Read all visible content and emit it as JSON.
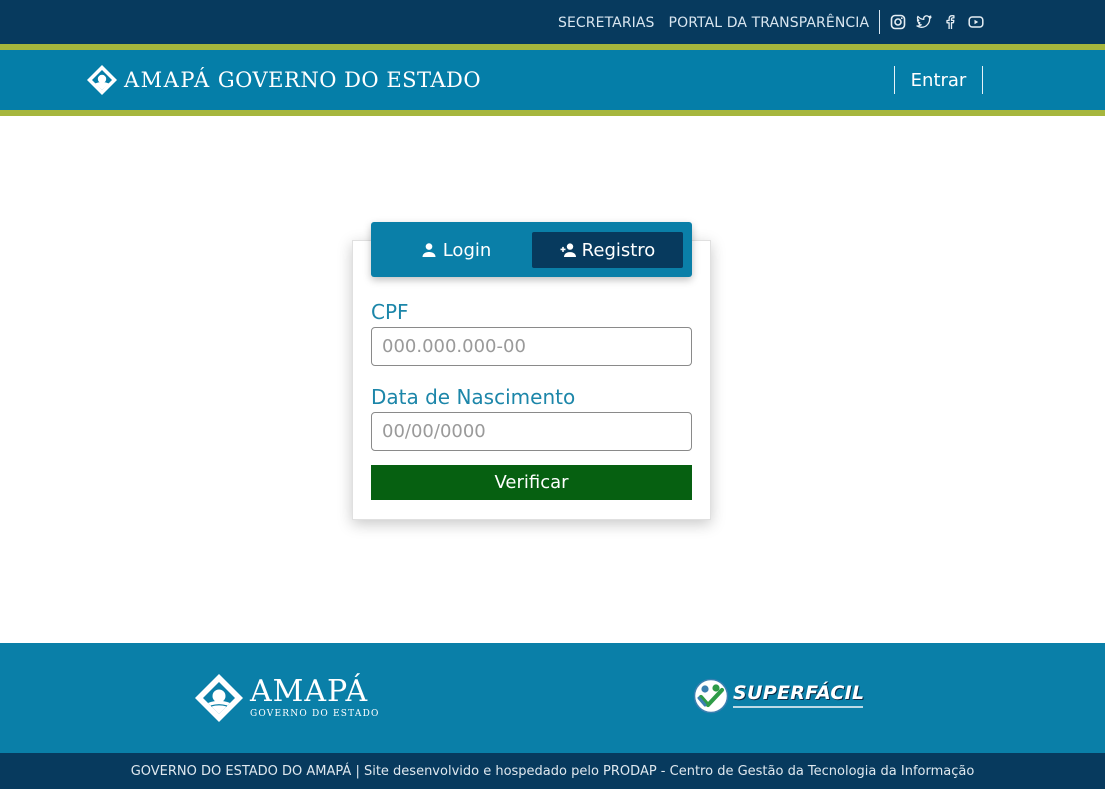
{
  "topbar": {
    "links": [
      "SECRETARIAS",
      "PORTAL DA TRANSPARÊNCIA"
    ],
    "socials": [
      "instagram-icon",
      "twitter-icon",
      "facebook-icon",
      "youtube-icon"
    ]
  },
  "header": {
    "brand_strong": "AMAPÁ",
    "brand_rest": "GOVERNO DO ESTADO",
    "login_link": "Entrar"
  },
  "tabs": [
    {
      "label": "Login",
      "icon": "person-icon",
      "active": false
    },
    {
      "label": "Registro",
      "icon": "person-add-icon",
      "active": true
    }
  ],
  "form": {
    "cpf_label": "CPF",
    "cpf_placeholder": "000.000.000-00",
    "birth_label": "Data de Nascimento",
    "birth_placeholder": "00/00/0000",
    "submit": "Verificar"
  },
  "footer": {
    "logo_big": "AMAPÁ",
    "logo_small": "GOVERNO DO ESTADO",
    "partner_name": "SUPERFÁCIL",
    "credits": "GOVERNO DO ESTADO DO AMAPÁ | Site desenvolvido e hospedado pelo PRODAP - Centro de Gestão da Tecnologia da Informação"
  },
  "colors": {
    "topbar": "#073a5e",
    "header": "#057ea8",
    "accent_stripe": "#a6b63d",
    "submit": "#066011",
    "label": "#1c86a9"
  }
}
